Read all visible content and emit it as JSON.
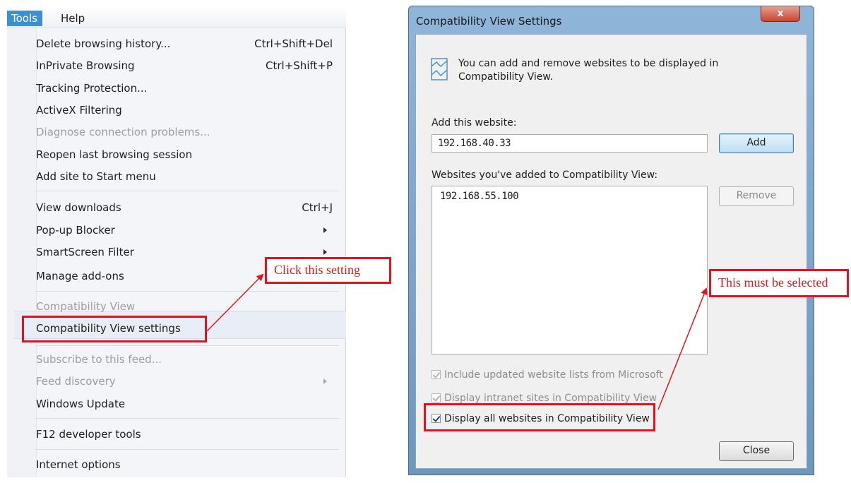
{
  "menubar": {
    "tools": "Tools",
    "help": "Help"
  },
  "menu": {
    "items": [
      {
        "label": "Delete browsing history...",
        "shortcut": "Ctrl+Shift+Del",
        "disabled": false
      },
      {
        "label": "InPrivate Browsing",
        "shortcut": "Ctrl+Shift+P",
        "disabled": false
      },
      {
        "label": "Tracking Protection...",
        "shortcut": "",
        "disabled": false
      },
      {
        "label": "ActiveX Filtering",
        "shortcut": "",
        "disabled": false
      },
      {
        "label": "Diagnose connection problems...",
        "shortcut": "",
        "disabled": true
      },
      {
        "label": "Reopen last browsing session",
        "shortcut": "",
        "disabled": false
      },
      {
        "label": "Add site to Start menu",
        "shortcut": "",
        "disabled": false
      },
      {
        "label": "View downloads",
        "shortcut": "Ctrl+J",
        "disabled": false
      },
      {
        "label": "Pop-up Blocker",
        "shortcut": "",
        "disabled": false
      },
      {
        "label": "SmartScreen Filter",
        "shortcut": "",
        "disabled": false
      },
      {
        "label": "Manage add-ons",
        "shortcut": "",
        "disabled": false
      },
      {
        "label": "Compatibility View",
        "shortcut": "",
        "disabled": true
      },
      {
        "label": "Compatibility View settings",
        "shortcut": "",
        "disabled": false
      },
      {
        "label": "Subscribe to this feed...",
        "shortcut": "",
        "disabled": true
      },
      {
        "label": "Feed discovery",
        "shortcut": "",
        "disabled": true
      },
      {
        "label": "Windows Update",
        "shortcut": "",
        "disabled": false
      },
      {
        "label": "F12 developer tools",
        "shortcut": "",
        "disabled": false
      },
      {
        "label": "Internet options",
        "shortcut": "",
        "disabled": false
      }
    ]
  },
  "callouts": {
    "click_setting": "Click this setting",
    "must_select": "This must be selected"
  },
  "dialog": {
    "title": "Compatibility View Settings",
    "close_x": "x",
    "intro": "You can add and remove websites to be displayed in Compatibility View.",
    "add_label": "Add this website:",
    "add_value": "192.168.40.33",
    "add_button": "Add",
    "list_label": "Websites you've added to Compatibility View:",
    "list_items": [
      "192.168.55.100"
    ],
    "remove_button": "Remove",
    "checkboxes": [
      {
        "label": "Include updated website lists from Microsoft",
        "checked": true,
        "disabled": true
      },
      {
        "label": "Display intranet sites in Compatibility View",
        "checked": true,
        "disabled": true
      },
      {
        "label": "Display all websites in Compatibility View",
        "checked": true,
        "disabled": false
      }
    ],
    "close_button": "Close"
  },
  "colors": {
    "annotation_red": "#e0141e",
    "menu_highlight": "#3c8ed6"
  }
}
